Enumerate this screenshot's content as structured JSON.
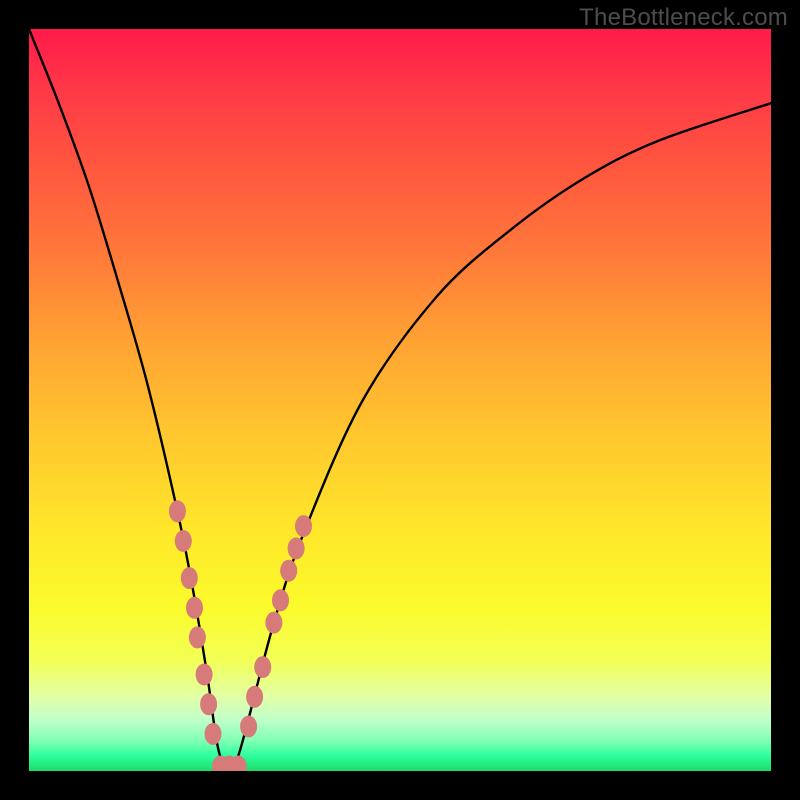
{
  "watermark": {
    "text": "TheBottleneck.com"
  },
  "colors": {
    "curve": "#000000",
    "marker_fill": "#d77a7a",
    "marker_stroke": "#b85f5f",
    "background_frame": "#000000"
  },
  "chart_data": {
    "type": "line",
    "title": "",
    "xlabel": "",
    "ylabel": "",
    "xlim": [
      0,
      100
    ],
    "ylim": [
      0,
      100
    ],
    "grid": false,
    "legend": false,
    "series": [
      {
        "name": "bottleneck-curve",
        "x": [
          0,
          4,
          8,
          12,
          16,
          20,
          22,
          24,
          25.5,
          27,
          28.5,
          33,
          37,
          45,
          55,
          65,
          75,
          85,
          100
        ],
        "y": [
          100,
          90,
          79,
          66,
          52,
          35,
          25,
          13,
          3,
          0,
          3,
          20,
          32,
          50,
          64,
          73,
          80,
          85,
          90
        ]
      }
    ],
    "markers": {
      "name": "highlight-points",
      "points": [
        {
          "x": 20.0,
          "y": 35
        },
        {
          "x": 20.8,
          "y": 31
        },
        {
          "x": 21.6,
          "y": 26
        },
        {
          "x": 22.3,
          "y": 22
        },
        {
          "x": 22.7,
          "y": 18
        },
        {
          "x": 23.6,
          "y": 13
        },
        {
          "x": 24.2,
          "y": 9
        },
        {
          "x": 24.8,
          "y": 5
        },
        {
          "x": 25.8,
          "y": 0.6
        },
        {
          "x": 27.0,
          "y": 0.6
        },
        {
          "x": 28.2,
          "y": 0.6
        },
        {
          "x": 29.6,
          "y": 6
        },
        {
          "x": 30.4,
          "y": 10
        },
        {
          "x": 31.5,
          "y": 14
        },
        {
          "x": 33.0,
          "y": 20
        },
        {
          "x": 33.9,
          "y": 23
        },
        {
          "x": 35.0,
          "y": 27
        },
        {
          "x": 36.0,
          "y": 30
        },
        {
          "x": 37.0,
          "y": 33
        }
      ]
    }
  }
}
